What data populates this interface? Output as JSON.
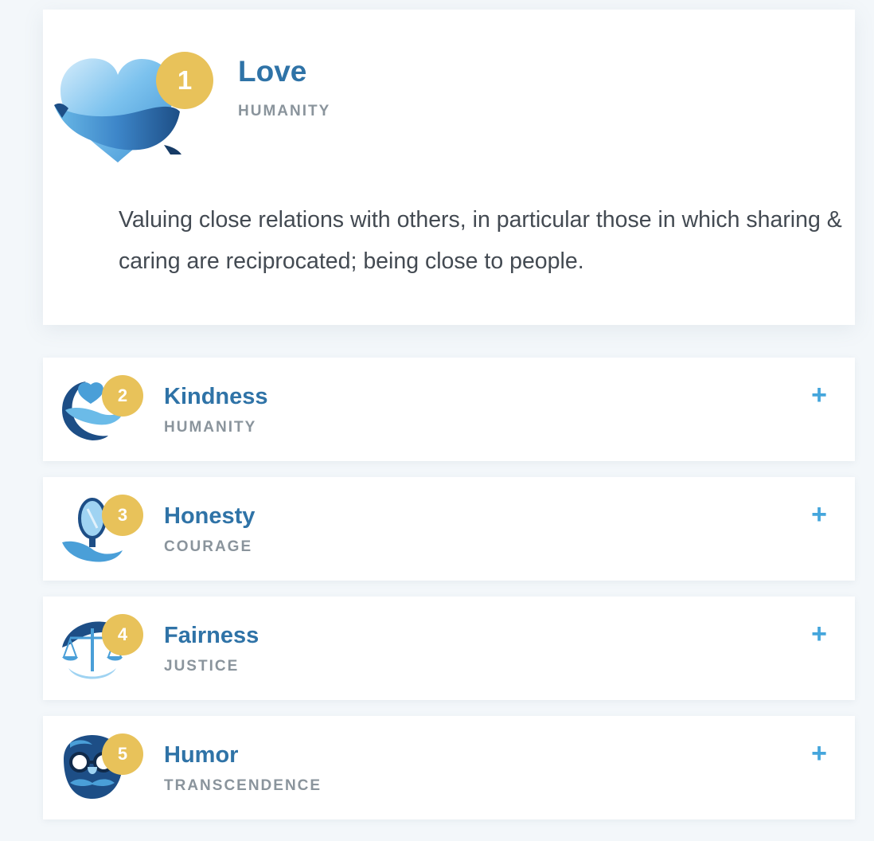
{
  "featured": {
    "rank": "1",
    "title": "Love",
    "category": "HUMANITY",
    "description": "Valuing close relations with others, in particular those in which sharing & caring are reciprocated; being close to people.",
    "icon": "heart-icon"
  },
  "strengths": [
    {
      "rank": "2",
      "title": "Kindness",
      "category": "HUMANITY",
      "expand_label": "+",
      "icon": "kindness-icon"
    },
    {
      "rank": "3",
      "title": "Honesty",
      "category": "COURAGE",
      "expand_label": "+",
      "icon": "mirror-icon"
    },
    {
      "rank": "4",
      "title": "Fairness",
      "category": "JUSTICE",
      "expand_label": "+",
      "icon": "scales-icon"
    },
    {
      "rank": "5",
      "title": "Humor",
      "category": "TRANSCENDENCE",
      "expand_label": "+",
      "icon": "funny-glasses-icon"
    }
  ],
  "colors": {
    "badge": "#e8c25a",
    "title": "#2f73a7",
    "category": "#8a949c",
    "expand": "#45a6dc",
    "icon_light": "#9fd3f2",
    "icon_mid": "#4a9fd8",
    "icon_dark": "#1d4e86"
  }
}
